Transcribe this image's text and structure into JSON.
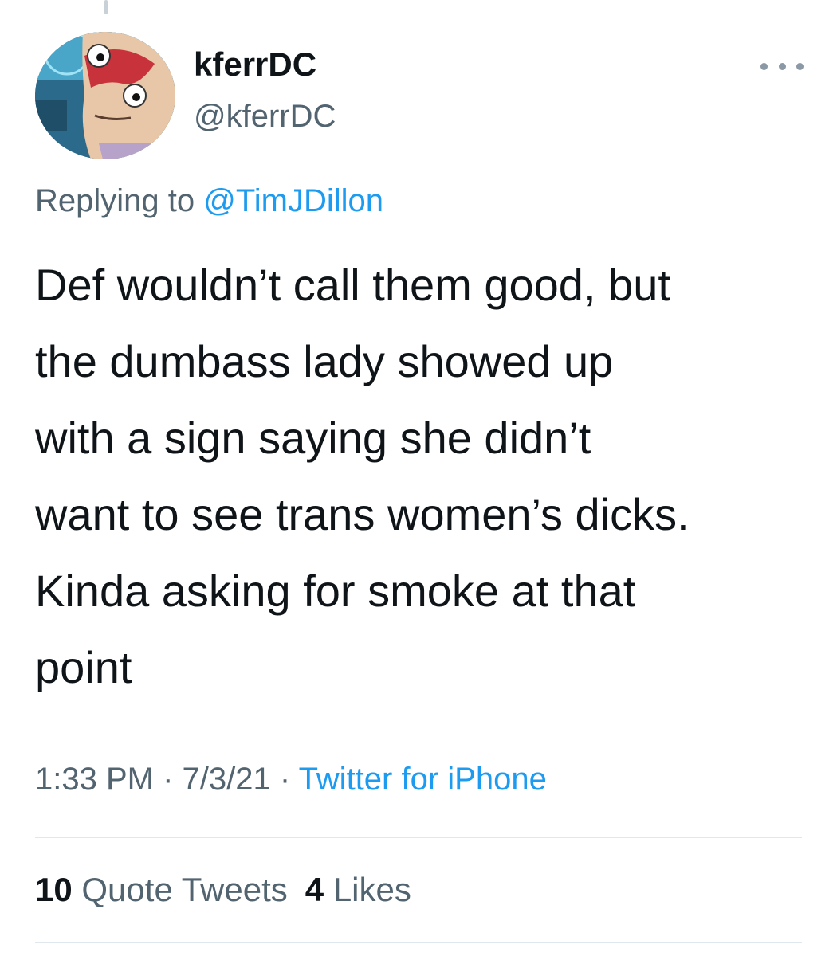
{
  "tweet": {
    "author": {
      "display_name": "kferrDC",
      "handle": "@kferrDC",
      "avatar_icon": "cartoon-character-avatar"
    },
    "more_icon": "more-dots-icon",
    "reply": {
      "prefix": "Replying to ",
      "mention": "@TimJDillon"
    },
    "text": "Def wouldn’t call them good, but\nthe dumbass lady showed up\nwith a sign saying she didn’t\nwant to see trans women’s dicks.\nKinda asking for smoke at that\npoint",
    "time": "1:33 PM",
    "date": "7/3/21",
    "separator": " · ",
    "source": "Twitter for iPhone",
    "stats": {
      "quote_tweets": {
        "count": "10",
        "label": "Quote Tweets"
      },
      "likes": {
        "count": "4",
        "label": "Likes"
      }
    }
  },
  "colors": {
    "text": "#0f1419",
    "secondary": "#536471",
    "link": "#1d9bf0",
    "divider": "#e1e8ed"
  }
}
